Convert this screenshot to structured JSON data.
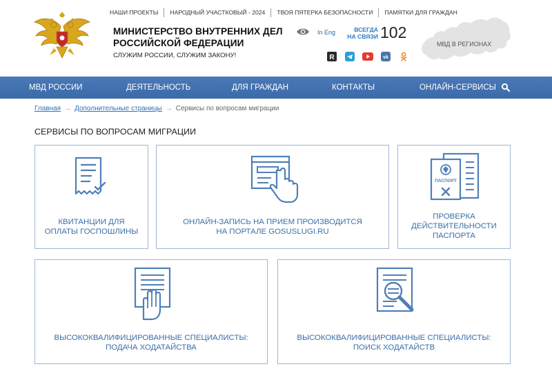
{
  "header": {
    "title_line1": "МИНИСТЕРСТВО ВНУТРЕННИХ ДЕЛ",
    "title_line2": "РОССИЙСКОЙ ФЕДЕРАЦИИ",
    "motto": "СЛУЖИМ РОССИИ, СЛУЖИМ ЗАКОНУ!",
    "emblem_icon": "double-headed-eagle-emblem",
    "accessibility_icon": "eye-icon",
    "lang_label": "In Eng",
    "helpline_line1": "ВСЕГДА",
    "helpline_line2": "НА СВЯЗИ",
    "hotline_number": "102",
    "regions_label": "МВД В РЕГИОНАХ",
    "socials": [
      "rutube-icon",
      "telegram-icon",
      "youtube-icon",
      "vk-icon",
      "odnoklassniki-icon"
    ]
  },
  "topnav": [
    "НАШИ ПРОЕКТЫ",
    "НАРОДНЫЙ УЧАСТКОВЫЙ - 2024",
    "ТВОЯ ПЯТЕРКА БЕЗОПАСНОСТИ",
    "ПАМЯТКИ ДЛЯ ГРАЖДАН"
  ],
  "mainnav": [
    "МВД РОССИИ",
    "ДЕЯТЕЛЬНОСТЬ",
    "ДЛЯ ГРАЖДАН",
    "КОНТАКТЫ",
    "ОНЛАЙН-СЕРВИСЫ"
  ],
  "breadcrumb": {
    "home": "Главная",
    "parent": "Дополнительные страницы",
    "current": "Сервисы по вопросам миграции",
    "separator": "→"
  },
  "page_title": "СЕРВИСЫ ПО ВОПРОСАМ МИГРАЦИИ",
  "cards": [
    {
      "icon": "receipt-icon",
      "line1": "КВИТАНЦИИ ДЛЯ",
      "line2": "ОПЛАТЫ ГОСПОШЛИНЫ"
    },
    {
      "icon": "touch-form-icon",
      "line1": "ОНЛАЙН-ЗАПИСЬ НА ПРИЕМ ПРОИЗВОДИТСЯ",
      "line2": "НА ПОРТАЛЕ GOSUSLUGI.RU"
    },
    {
      "icon": "passport-check-icon",
      "line1": "ПРОВЕРКА",
      "line2": "ДЕЙСТВИТЕЛЬНОСТИ",
      "line3": "ПАСПОРТА",
      "passport_word": "ПАСПОРТ"
    },
    {
      "icon": "document-hand-icon",
      "line1": "ВЫСОКОКВАЛИФИЦИРОВАННЫЕ СПЕЦИАЛИСТЫ:",
      "line2": "ПОДАЧА ХОДАТАЙСТВА"
    },
    {
      "icon": "document-search-icon",
      "line1": "ВЫСОКОКВАЛИФИЦИРОВАННЫЕ СПЕЦИАЛИСТЫ:",
      "line2": "ПОИСК ХОДАТАЙСТВ"
    }
  ],
  "colors": {
    "nav_bg": "#3f6fae",
    "accent_blue": "#3a6ea8",
    "card_border": "#9fb6d2",
    "link": "#2f72b5"
  }
}
